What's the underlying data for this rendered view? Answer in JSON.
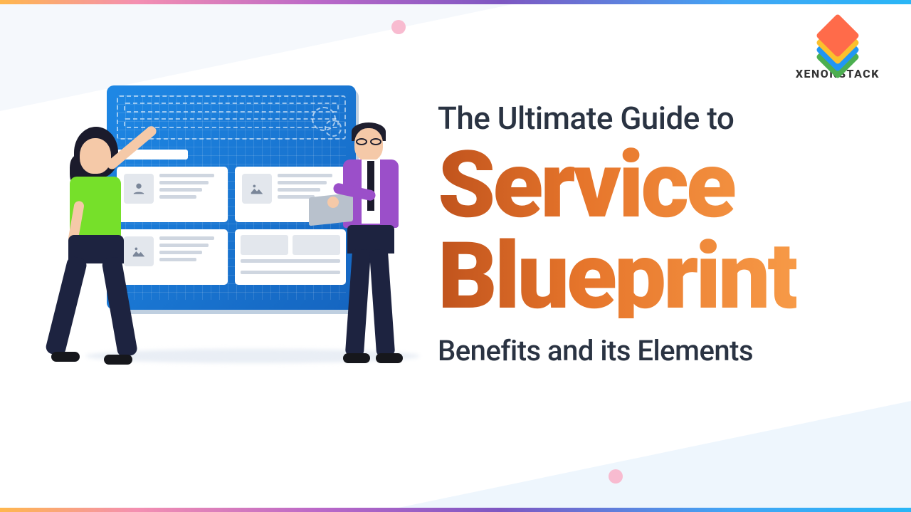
{
  "logo": {
    "brand": "XENONSTACK"
  },
  "headline": {
    "line1": "The Ultimate Guide to",
    "big1": "Service",
    "big2": "Blueprint",
    "line4": "Benefits and its Elements"
  }
}
